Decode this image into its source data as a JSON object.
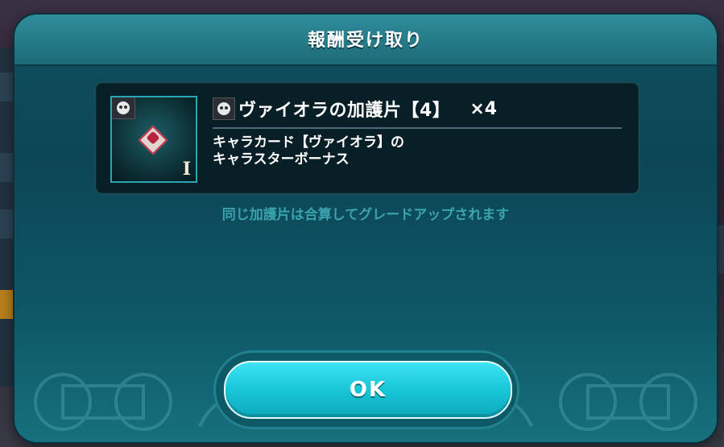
{
  "dialog": {
    "title": "報酬受け取り"
  },
  "reward": {
    "name": "ヴァイオラの加護片【4】",
    "quantity": "×4",
    "grade": "I",
    "description_line1": "キャラカード【ヴァイオラ】の",
    "description_line2": "キャラスターボーナス"
  },
  "note": "同じ加護片は合算してグレードアップされます",
  "ok_button": {
    "label": "OK"
  },
  "colors": {
    "dialog_bg": "#0c4656",
    "button_accent": "#18c6d8",
    "note_text": "#3aa3ad"
  },
  "icons": {
    "reward_type": "skull-icon",
    "character": "character-portrait-icon"
  }
}
